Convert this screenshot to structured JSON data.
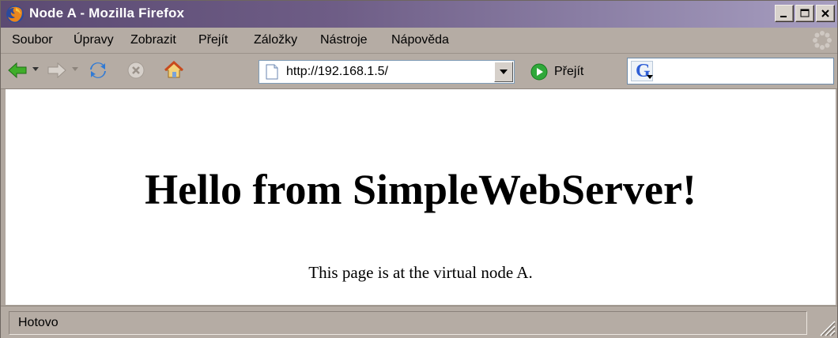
{
  "window": {
    "title": "Node A - Mozilla Firefox",
    "controls": [
      "_",
      "□",
      "X"
    ]
  },
  "menu": {
    "items": [
      "Soubor",
      "Úpravy",
      "Zobrazit",
      "Přejít",
      "Záložky",
      "Nástroje",
      "Nápověda"
    ]
  },
  "toolbar": {
    "url": "http://192.168.1.5/",
    "go_label": "Přejít",
    "search_value": "",
    "search_engine_icon": "google-icon"
  },
  "page": {
    "heading": "Hello from SimpleWebServer!",
    "text": "This page is at the virtual node A."
  },
  "status": {
    "text": "Hotovo"
  },
  "colors": {
    "titlebar_start": "#5b4a72",
    "titlebar_end": "#a79ec0",
    "chrome": "#b5aca4",
    "back_arrow": "#3fae2a",
    "go_button": "#2fa83a"
  }
}
